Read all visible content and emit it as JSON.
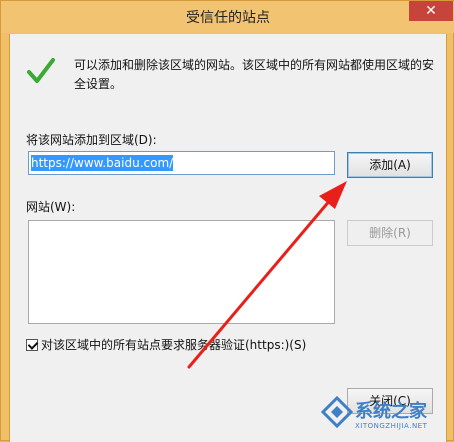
{
  "window": {
    "title": "受信任的站点",
    "close": "✕"
  },
  "info_text": "可以添加和删除该区域的网站。该区域中的所有网站都使用区域的安全设置。",
  "add_label": "将该网站添加到区域(D):",
  "url_value": "https://www.baidu.com/",
  "buttons": {
    "add": "添加(A)",
    "remove": "删除(R)",
    "close": "关闭(C)"
  },
  "sites_label": "网站(W):",
  "sites": [],
  "https_checkbox": {
    "label": "对该区域中的所有站点要求服务器验证(https:)(S)",
    "checked": true
  },
  "watermark": {
    "text": "系统之家",
    "sub": "XITONGZHIJIA.NET"
  },
  "colors": {
    "frame": "#f0c069",
    "arrow": "#e8201c",
    "close": "#c7443a",
    "check": "#3aaa35",
    "watermark": "#3f7fc6"
  },
  "icons": [
    "checkmark-icon",
    "close-icon",
    "red-arrow-annotation",
    "watermark-logo"
  ]
}
